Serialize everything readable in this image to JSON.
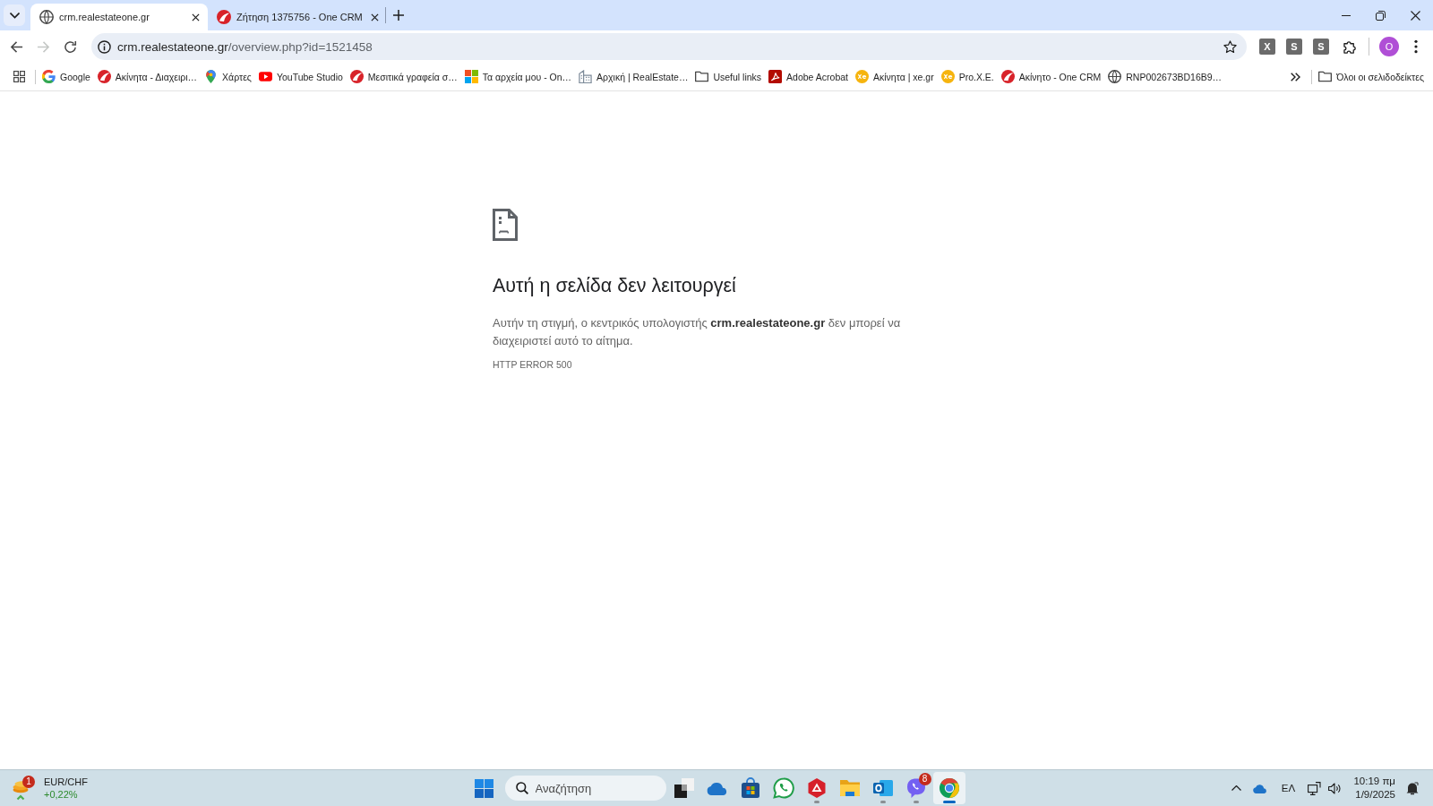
{
  "tabs": [
    {
      "title": "crm.realestateone.gr",
      "kind": "globe",
      "selected": true
    },
    {
      "title": "Ζήτηση 1375756 - One CRM",
      "kind": "swoosh",
      "selected": false
    }
  ],
  "toolbar": {
    "nav_buttons": [
      {
        "kind": "back",
        "disabled": false
      },
      {
        "kind": "forward",
        "disabled": true
      },
      {
        "kind": "reload",
        "disabled": false
      }
    ],
    "address": {
      "host": "crm.realestateone.gr",
      "path": "/overview.php?id=1521458"
    },
    "starred": false,
    "extensions": [
      {
        "label": "X"
      },
      {
        "label": "S"
      },
      {
        "label": "S"
      }
    ],
    "profile_initial": "O"
  },
  "bookmarks_bar": {
    "items": [
      {
        "title": "Google",
        "kind": "letter"
      },
      {
        "title": "Ακίνητα - Διαχειρι…",
        "kind": "swoosh"
      },
      {
        "title": "Χάρτες",
        "kind": "pin"
      },
      {
        "title": "YouTube Studio",
        "kind": "play"
      },
      {
        "title": "Μεσιτικά γραφεία σ…",
        "kind": "swoosh"
      },
      {
        "title": "Τα αρχεία μου - On…",
        "kind": "tiles"
      },
      {
        "title": "Αρχική | RealEstate…",
        "kind": "building"
      },
      {
        "title": "Useful links",
        "kind": "folder"
      },
      {
        "title": "Adobe Acrobat",
        "kind": "pdf"
      },
      {
        "title": "Ακίνητα | xe.gr",
        "kind": "coin"
      },
      {
        "title": "Pro.X.E.",
        "kind": "coin"
      },
      {
        "title": "Ακίνητο - One CRM",
        "kind": "swoosh"
      },
      {
        "title": "RNP002673BD16B9…",
        "kind": "globe"
      }
    ],
    "all_bookmarks": "Όλοι οι σελιδοδείκτες"
  },
  "error_page": {
    "heading": "Αυτή η σελίδα δεν λειτουργεί",
    "message": "Αυτήν τη στιγμή, ο κεντρικός υπολογιστής **crm.realestateone.gr** δεν μπορεί να διαχειριστεί αυτό το αίτημα.",
    "code": "HTTP ERROR 500"
  },
  "taskbar": {
    "widget": {
      "badge": "1",
      "title": "EUR/CHF",
      "change": "+0,22%"
    },
    "search": {
      "placeholder": "Αναζήτηση"
    },
    "apps": [
      {
        "kind": "squares",
        "running": false,
        "selected": false
      },
      {
        "kind": "cloud",
        "running": false,
        "selected": false
      },
      {
        "kind": "bag",
        "running": false,
        "selected": false
      },
      {
        "kind": "chat",
        "running": false,
        "selected": false
      },
      {
        "kind": "hexagon",
        "running": true,
        "selected": false
      },
      {
        "kind": "folder",
        "running": false,
        "selected": false
      },
      {
        "kind": "mail",
        "running": true,
        "selected": false
      },
      {
        "kind": "bubble",
        "running": true,
        "selected": false,
        "badge": "8"
      },
      {
        "kind": "browser",
        "running": true,
        "selected": true
      }
    ],
    "tray": {
      "language": "ΕΛ",
      "time": "10:19 πμ",
      "date": "1/9/2025"
    }
  }
}
